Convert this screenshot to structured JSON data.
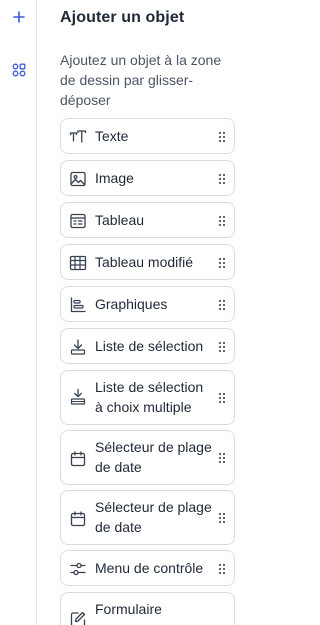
{
  "panel": {
    "title": "Ajouter un objet",
    "description": "Ajoutez un objet à la zone de dessin par glisser-déposer"
  },
  "rail": {
    "items": [
      {
        "icon": "plus-icon"
      },
      {
        "icon": "components-icon"
      }
    ]
  },
  "objects": [
    {
      "label": "Texte",
      "icon": "text-icon"
    },
    {
      "label": "Image",
      "icon": "image-icon"
    },
    {
      "label": "Tableau",
      "icon": "table-icon"
    },
    {
      "label": "Tableau modifié",
      "icon": "grid-table-icon"
    },
    {
      "label": "Graphiques",
      "icon": "chart-icon"
    },
    {
      "label": "Liste de sélection",
      "icon": "dropdown-list-icon"
    },
    {
      "label": "Liste de sélection à choix multiple",
      "icon": "multi-select-list-icon"
    },
    {
      "label": "Sélecteur de plage de date",
      "icon": "calendar-icon"
    },
    {
      "label": "Sélecteur de plage de date",
      "icon": "calendar-icon"
    },
    {
      "label": "Menu de contrôle",
      "icon": "sliders-icon"
    },
    {
      "label": "Formulaire",
      "icon": "form-edit-icon"
    }
  ],
  "colors": {
    "accent": "#3b5bdb",
    "text": "#1f2937",
    "muted": "#4b5563",
    "border": "#d9dde3"
  }
}
